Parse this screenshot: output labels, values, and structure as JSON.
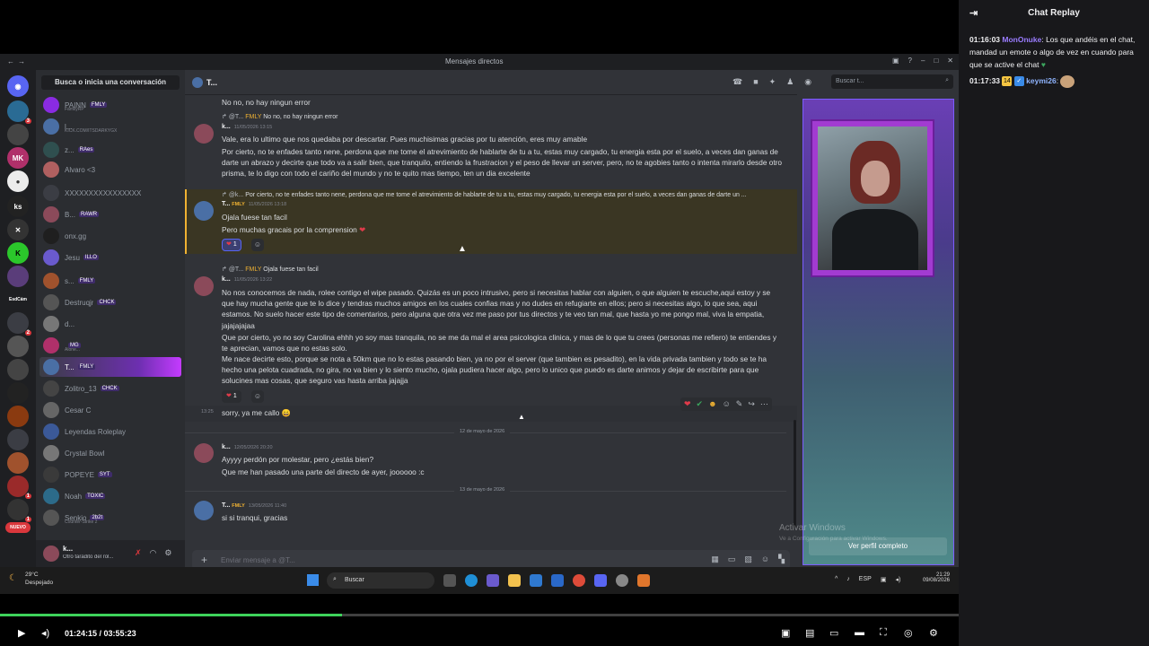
{
  "discord": {
    "window_title": "Mensajes directos",
    "dm_search": "Busca o inicia una conversación",
    "search_placeholder": "Buscar t...",
    "channel_name": "T...",
    "dms": [
      {
        "name": "PAINN",
        "tag": "FMLY",
        "sub": "FamilyRP"
      },
      {
        "name": "l...",
        "tag": "",
        "sub": "KICK.COM/ITSDARKYGX"
      },
      {
        "name": "z...",
        "tag": "RAes",
        "sub": ""
      },
      {
        "name": "Alvaro <3",
        "tag": "",
        "sub": ""
      },
      {
        "name": "XXXXXXXXXXXXXXXX",
        "tag": "",
        "sub": ""
      },
      {
        "name": "B...",
        "tag": "RAWR",
        "sub": ""
      },
      {
        "name": "onx.gg",
        "tag": "",
        "sub": ""
      },
      {
        "name": "Jesu",
        "tag": "ILLO",
        "sub": ""
      },
      {
        "name": "s...",
        "tag": "FMLY",
        "sub": ""
      },
      {
        "name": "Destruqjr",
        "tag": "CHCK",
        "sub": ""
      },
      {
        "name": "d...",
        "tag": "",
        "sub": ""
      },
      {
        "name": "",
        "tag": "MG",
        "sub": "Alone..."
      },
      {
        "name": "T...",
        "tag": "FMLY",
        "sub": ""
      },
      {
        "name": "Zolitro_13",
        "tag": "CHCK",
        "sub": ""
      },
      {
        "name": "Cesar C",
        "tag": "",
        "sub": ""
      },
      {
        "name": "Leyendas Roleplay",
        "tag": "",
        "sub": ""
      },
      {
        "name": "Crystal Bowl",
        "tag": "",
        "sub": ""
      },
      {
        "name": "POPEYE",
        "tag": "SYT",
        "sub": ""
      },
      {
        "name": "Noah",
        "tag": "TOXIC",
        "sub": ""
      },
      {
        "name": "Senkio",
        "tag": "2b2t",
        "sub": "Counter-Strike 2"
      }
    ],
    "user": {
      "name": "k...",
      "status": "Otro taradito del rol..."
    },
    "servers_labels": {
      "ks": "ks",
      "esdcam": "EsdCám",
      "nuevo": "NUEVO"
    },
    "messages": {
      "m0_text": "No no, no hay ningun error",
      "m1_reply_user": "@T...",
      "m1_reply_tag": "FMLY",
      "m1_reply_text": "No no, no hay ningun error",
      "m1_author": "k...",
      "m1_time": "11/05/2026 13:15",
      "m1_p1": "Vale, era lo ultimo que nos quedaba por descartar. Pues muchisimas gracias por tu atención, eres muy amable",
      "m1_p2": "Por cierto, no te enfades tanto nene, perdona que me tome el atrevimiento de hablarte de tu a tu, estas muy cargado, tu energia esta por el suelo, a veces dan ganas de darte un abrazo y decirte que todo va a salir bien, que tranquilo, entiendo la frustracion y el peso de llevar un server, pero, no te agobies tanto o intenta mirarlo desde otro prisma, te lo digo con todo el cariño del mundo y no te quito mas tiempo, ten un dia excelente",
      "m2_reply_user": "@k...",
      "m2_reply_text": "Por cierto, no te enfades tanto nene, perdona que me tome el atrevimiento de hablarte de tu a tu, estas muy cargado, tu energia esta por el suelo, a veces dan ganas de darte un ...",
      "m2_author": "T...",
      "m2_tag": "FMLY",
      "m2_time": "11/05/2026 13:18",
      "m2_p1": "Ojala fuese tan facil",
      "m2_p2": "Pero muchas gracais por la comprension",
      "m2_react_count": "1",
      "m3_reply_user": "@T...",
      "m3_reply_tag": "FMLY",
      "m3_reply_text": "Ojala fuese tan facil",
      "m3_author": "k...",
      "m3_time": "11/05/2026 13:22",
      "m3_p1": "No nos conocemos de nada, rolee contigo el wipe pasado. Quizás es un poco intrusivo, pero si necesitas hablar con alguien, o que alguien te escuche,aqui estoy y se que hay mucha gente que te lo dice y tendras muchos amigos en los cuales confias mas y no dudes en refugiarte en ellos; pero si necesitas algo, lo que sea, aqui estamos. No suelo hacer este tipo de comentarios, pero alguna que otra vez me paso por tus directos y te veo tan mal, que hasta yo me pongo mal, viva la empatia, jajajajajaa",
      "m3_p2": "Que por cierto, yo no soy Carolina ehhh yo soy mas tranquila, no se me da mal el area psicologica clinica, y mas de lo que tu crees (personas me refiero) te entiendes y te aprecian, vamos que no estas solo.",
      "m3_p3": "Me nace decirte esto, porque se nota a 50km que no lo estas pasando bien, ya no por el server (que tambien es pesadito), en la vida privada tambien y todo se te ha hecho una pelota cuadrada, no gira, no va bien y lo siento mucho, ojala pudiera hacer algo, pero lo unico que puedo es darte animos y dejar de escribirte para que solucines mas cosas, que seguro vas hasta arriba jajajja",
      "m3_react_count": "1",
      "m4_time": "13:25",
      "m4_text": "sorry, ya me callo",
      "div1": "12 de mayo de 2026",
      "m5_author": "k...",
      "m5_time": "12/05/2026 20:20",
      "m5_p1": "Ayyyy perdón por molestar, pero ¿estás bien?",
      "m5_p2": "Que me han pasado una parte del directo de ayer, joooooo :c",
      "div2": "13 de mayo de 2026",
      "m6_author": "T...",
      "m6_tag": "FMLY",
      "m6_time": "13/05/2026 11:40",
      "m6_text": "si si tranqui, gracias"
    },
    "composer_placeholder": "Enviar mensaje a @T...",
    "profile_button": "Ver perfil completo",
    "activate_windows": "Activar Windows",
    "activate_windows_sub": "Ve a Configuración para activar Windows."
  },
  "taskbar": {
    "weather_temp": "29°C",
    "weather_desc": "Despejado",
    "search": "Buscar",
    "lang": "ESP",
    "clock_time": "21:29",
    "clock_date": "09/08/2026"
  },
  "player": {
    "current_time": "01:24:15",
    "separator": " / ",
    "duration": "03:55:23",
    "progress_fraction": 0.357
  },
  "replay": {
    "title": "Chat Replay",
    "messages": [
      {
        "time": "01:16:03",
        "user": "MonOnuke",
        "user_color": "#9a7cff",
        "text": "Los que andéis en el chat, mandad un emote o algo de vez en cuando para que se active el chat"
      },
      {
        "time": "01:17:33",
        "badge": "14",
        "user": "keymi26",
        "user_color": "#8fb4ff",
        "text": ""
      }
    ]
  }
}
